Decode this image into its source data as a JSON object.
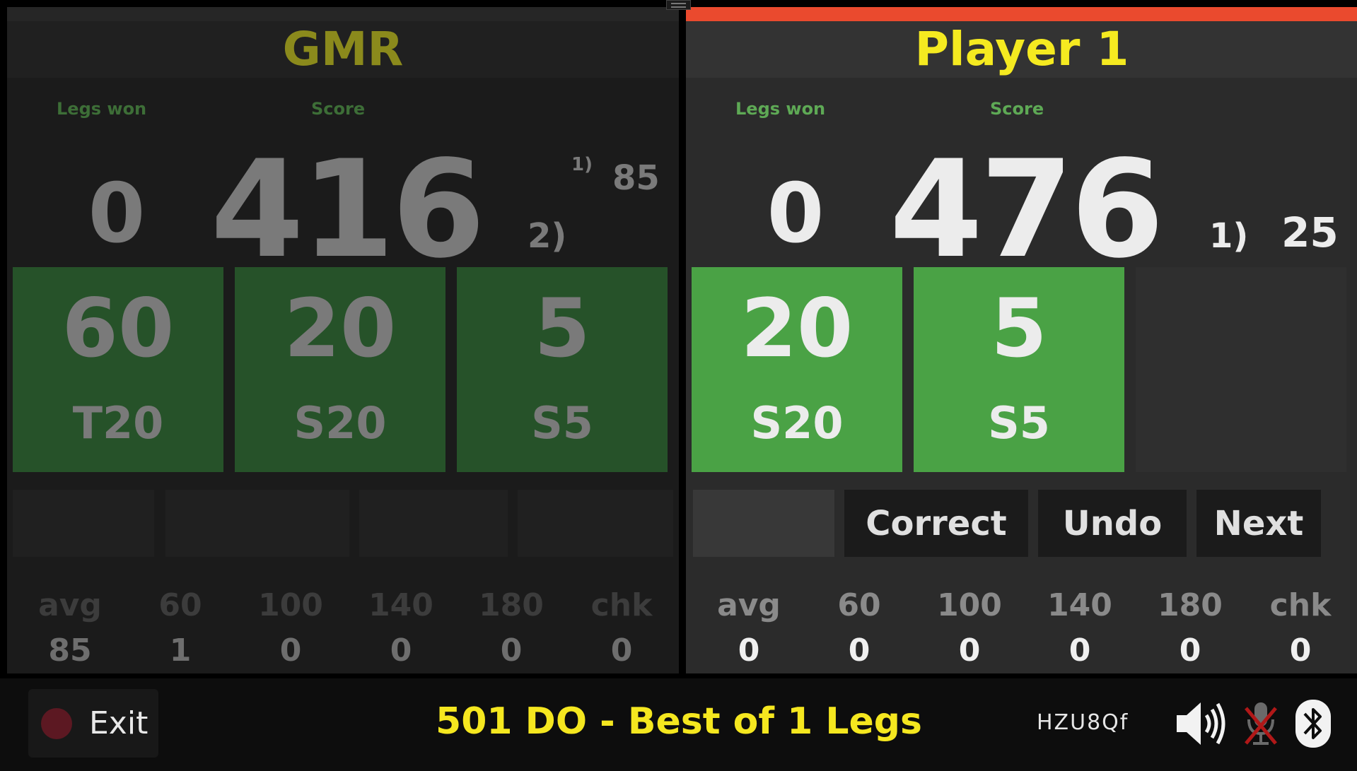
{
  "players": [
    {
      "name": "GMR",
      "name_color": "#8b8a1c",
      "legs_label": "Legs won",
      "score_label": "Score",
      "legs_won": "0",
      "score": "416",
      "suggestions": [
        {
          "index": "1)",
          "value": "85"
        },
        {
          "index": "2)",
          "value": ""
        }
      ],
      "darts": [
        {
          "points": "60",
          "segment": "T20"
        },
        {
          "points": "20",
          "segment": "S20"
        },
        {
          "points": "5",
          "segment": "S5"
        }
      ],
      "stats": [
        {
          "label": "avg",
          "value": "85"
        },
        {
          "label": "60",
          "value": "1"
        },
        {
          "label": "100",
          "value": "0"
        },
        {
          "label": "140",
          "value": "0"
        },
        {
          "label": "180",
          "value": "0"
        },
        {
          "label": "chk",
          "value": "0"
        }
      ]
    },
    {
      "name": "Player 1",
      "name_color": "#f5ea20",
      "active_bar_color": "#ea4a2e",
      "legs_label": "Legs won",
      "score_label": "Score",
      "legs_won": "0",
      "score": "476",
      "suggestions": [
        {
          "index": "1)",
          "value": "25"
        }
      ],
      "darts": [
        {
          "points": "20",
          "segment": "S20"
        },
        {
          "points": "5",
          "segment": "S5"
        }
      ],
      "buttons": {
        "correct": "Correct",
        "undo": "Undo",
        "next": "Next"
      },
      "stats": [
        {
          "label": "avg",
          "value": "0"
        },
        {
          "label": "60",
          "value": "0"
        },
        {
          "label": "100",
          "value": "0"
        },
        {
          "label": "140",
          "value": "0"
        },
        {
          "label": "180",
          "value": "0"
        },
        {
          "label": "chk",
          "value": "0"
        }
      ]
    }
  ],
  "footer": {
    "exit_label": "Exit",
    "game_title": "501 DO - Best of 1 Legs",
    "session_code": "HZU8Qf",
    "icons": [
      "speaker-icon",
      "microphone-muted-icon",
      "bluetooth-icon"
    ]
  }
}
